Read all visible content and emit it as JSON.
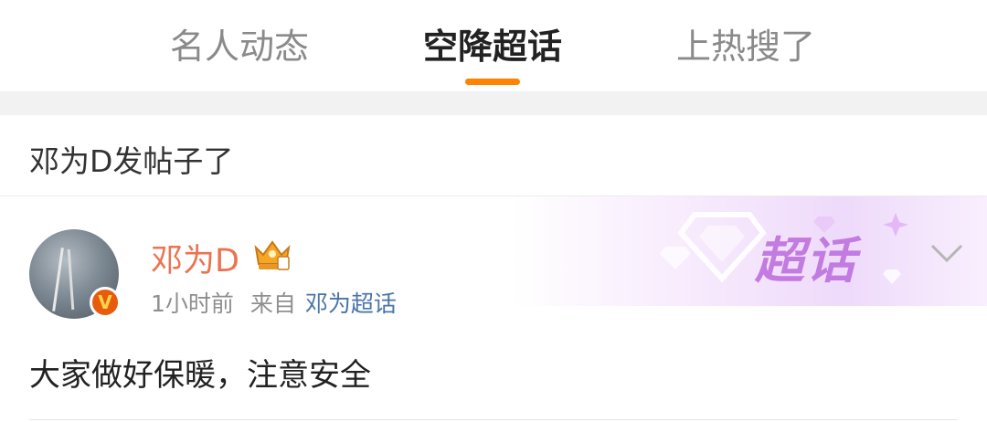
{
  "tabs": [
    {
      "label": "名人动态",
      "active": false
    },
    {
      "label": "空降超话",
      "active": true
    },
    {
      "label": "上热搜了",
      "active": false
    }
  ],
  "section": {
    "title": "邓为D发帖子了"
  },
  "post": {
    "username": "邓为D",
    "time": "1小时前",
    "from_label": "来自",
    "source": "邓为超话",
    "content": "大家做好保暖，注意安全",
    "badge_text": "V",
    "tag_label": "超话"
  },
  "colors": {
    "accent": "#ff8200",
    "username": "#eb7350",
    "link": "#4a74a8",
    "tag": "#c27be0"
  }
}
